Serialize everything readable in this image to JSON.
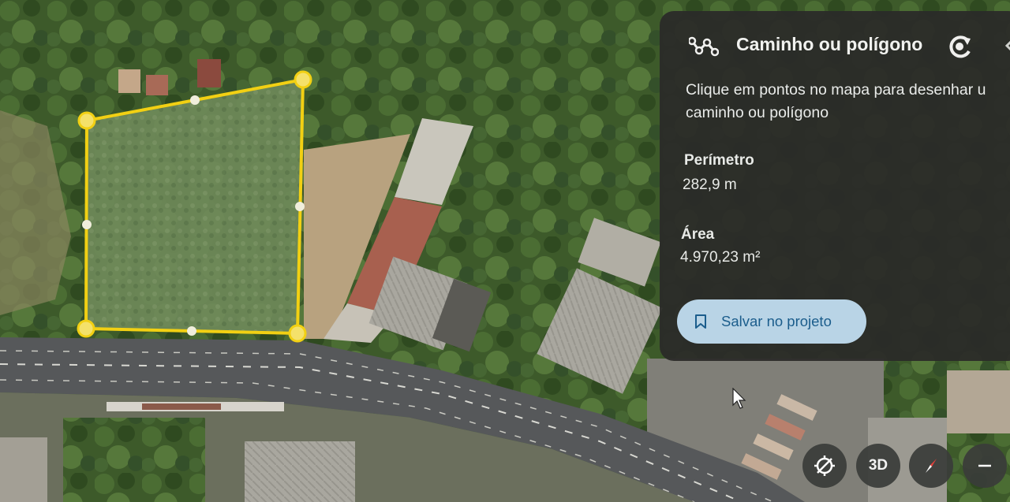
{
  "panel": {
    "title": "Caminho ou polígono",
    "instruction_line1": "Clique em pontos no mapa para desenhar u",
    "instruction_line2": "caminho ou polígono",
    "perimeter_label": "Perímetro",
    "perimeter_value": "282,9 m",
    "area_label": "Área",
    "area_value": "4.970,23 m²",
    "save_button": "Salvar no projeto",
    "icons": {
      "path": "path-polygon-icon",
      "refresh": "refresh-icon",
      "edge": "partial-edge-icon",
      "save": "bookmark-icon"
    }
  },
  "map_controls": {
    "reset_north": "compass-reset-icon",
    "view_3d": "3D",
    "compass": "compass-needle-icon",
    "zoom": "zoom-out-icon"
  },
  "colors": {
    "polygon": "#f2d013",
    "panel_bg": "#2b2b28",
    "button_bg": "#b9d4e6",
    "button_text": "#1b5d8c"
  }
}
